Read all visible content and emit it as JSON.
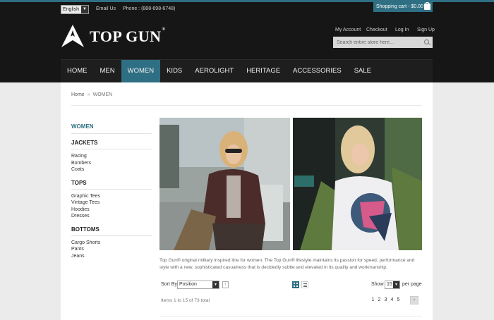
{
  "topbar": {
    "language": "English",
    "email_link": "Email Us",
    "phone": "Phone : (888-698-6748)",
    "cart": "Shopping cart - $0.00"
  },
  "brand": {
    "name": "TOP GUN",
    "reg": "®"
  },
  "account_links": [
    "My Account",
    "Checkout",
    "Log In",
    "Sign Up"
  ],
  "search": {
    "placeholder": "Search entire store here..."
  },
  "nav": [
    "HOME",
    "MEN",
    "WOMEN",
    "KIDS",
    "AEROLIGHT",
    "HERITAGE",
    "ACCESSORIES",
    "SALE"
  ],
  "nav_active": "WOMEN",
  "breadcrumb": {
    "home": "Home",
    "separator": "»",
    "current": "WOMEN"
  },
  "sidebar": {
    "heading": "WOMEN",
    "groups": [
      {
        "title": "JACKETS",
        "items": [
          "Racing",
          "Bombers",
          "Coats"
        ]
      },
      {
        "title": "TOPS",
        "items": [
          "Graphic Tees",
          "Vintage Tees",
          "Hoodies",
          "Dresses"
        ]
      },
      {
        "title": "BOTTOMS",
        "items": [
          "Cargo Shorts",
          "Pants",
          "Jeans"
        ]
      }
    ]
  },
  "description": "Top Gun® original military inspired line for women. The Top Gun® lifestyle maintains its passion for speed, performance and style with a new, sophisticated casualness that is decidedly subtle and elevated in its quality and workmanship.",
  "toolbar": {
    "sort_label": "Sort By",
    "sort_value": "Position",
    "show_label": "Show",
    "show_value": "15",
    "per_page": "per page"
  },
  "items_count": "Items 1 to 15 of 73 total",
  "pages": [
    "1",
    "2",
    "3",
    "4",
    "5"
  ],
  "colors": {
    "accent": "#2f6f83",
    "header": "#161616"
  }
}
